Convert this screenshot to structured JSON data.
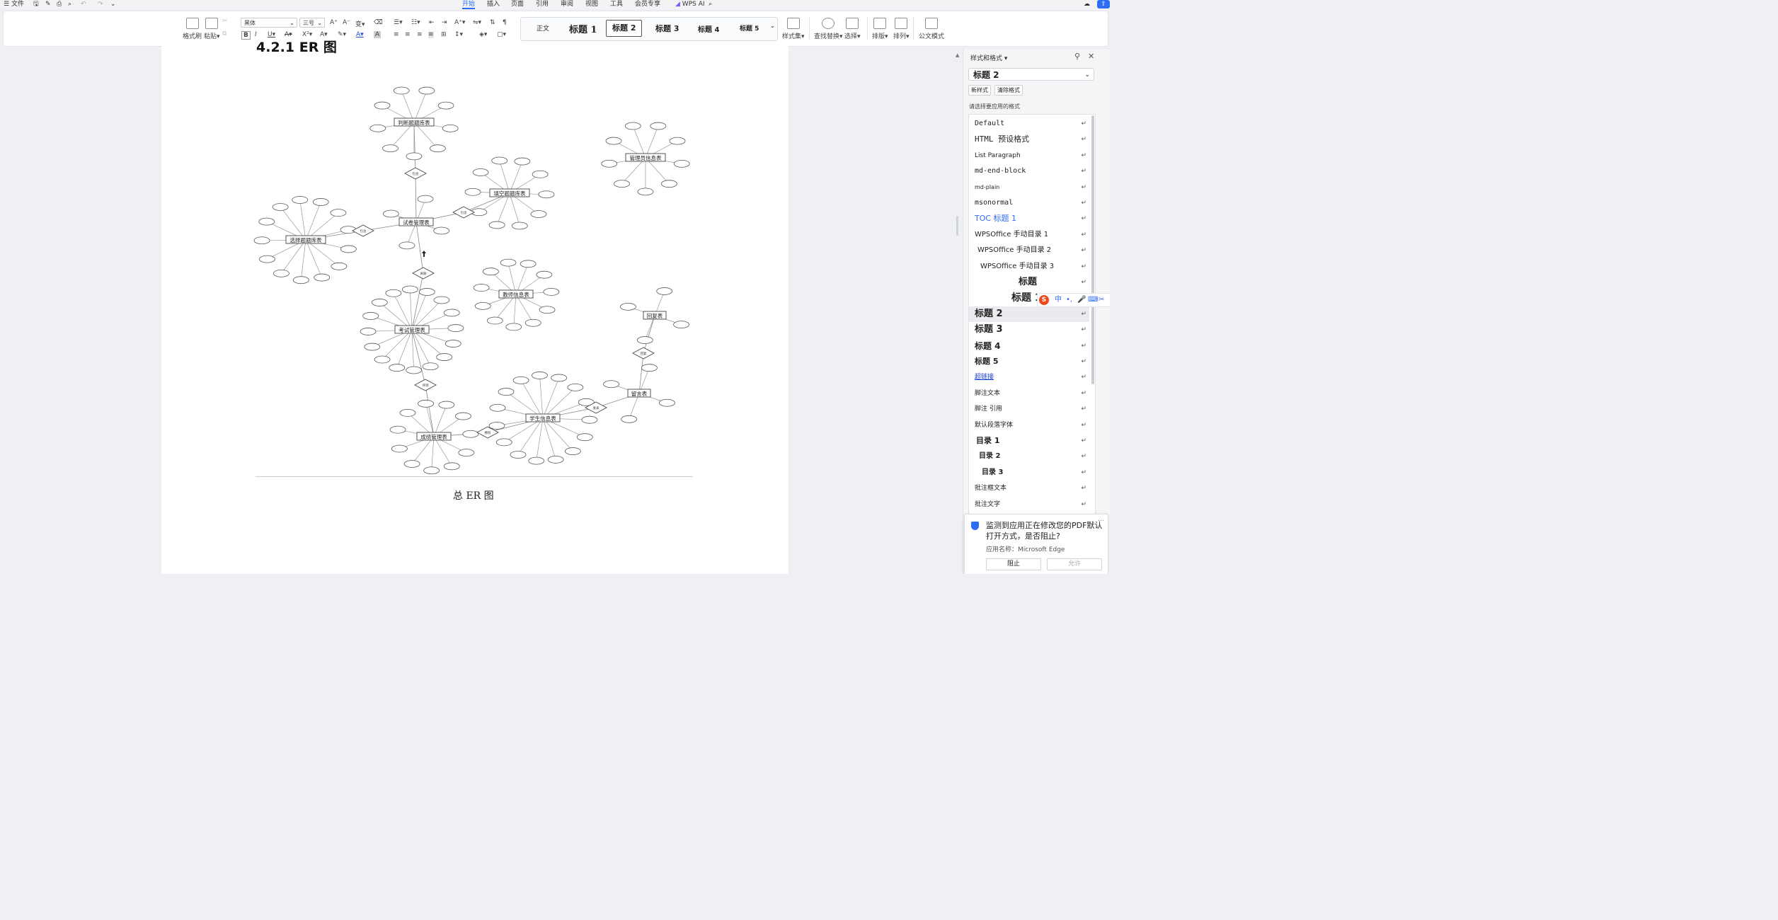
{
  "menu": {
    "file": "文件",
    "wps_ai": "WPS AI"
  },
  "tabs": [
    {
      "label": "开始",
      "active": true
    },
    {
      "label": "插入"
    },
    {
      "label": "页面"
    },
    {
      "label": "引用"
    },
    {
      "label": "审阅"
    },
    {
      "label": "视图"
    },
    {
      "label": "工具"
    },
    {
      "label": "会员专享"
    }
  ],
  "ribbon": {
    "format_painter": "格式刷",
    "paste": "粘贴",
    "font": "黑体",
    "size": "三号",
    "styles": [
      "正文",
      "标题 1",
      "标题 2",
      "标题 3",
      "标题 4",
      "标题 5"
    ],
    "style_set": "样式集",
    "find_replace": "查找替换",
    "select": "选择",
    "layout": "排版",
    "arrange": "排列",
    "official": "公文模式"
  },
  "document": {
    "heading": "4.2.1 ER 图",
    "caption": "总 ER 图"
  },
  "er_diagram": {
    "entities": [
      "判断题题库表",
      "填空题题库表",
      "试卷管理表",
      "选择题题库表",
      "管理员信息表",
      "教师信息表",
      "考试管理表",
      "回复表",
      "留言表",
      "学生信息表",
      "成绩管理表"
    ],
    "relations": [
      "包含",
      "包含",
      "包含",
      "关联",
      "评测",
      "拥有",
      "发表",
      "回复"
    ]
  },
  "panel": {
    "title": "样式和格式",
    "current": "标题 2",
    "new_style": "新样式",
    "clear": "清除格式",
    "hint": "请选择要应用的格式",
    "items": [
      "Default",
      "HTML 预设格式",
      "List Paragraph",
      "md-end-block",
      "md-plain",
      "msonormal",
      "TOC 标题 1",
      "WPSOffice 手动目录 1",
      "WPSOffice 手动目录 2",
      "WPSOffice 手动目录 3",
      "标题",
      "标题 1",
      "标题 2",
      "标题 3",
      "标题 4",
      "标题 5",
      "超链接",
      "脚注文本",
      "脚注 引用",
      "默认段落字体",
      "目录 1",
      "目录 2",
      "目录 3",
      "批注框文本",
      "批注文字"
    ]
  },
  "ime": {
    "label": "中"
  },
  "toast": {
    "message": "监测到应用正在修改您的PDF默认打开方式，是否阻止?",
    "app": "应用名称：Microsoft Edge",
    "block": "阻止",
    "allow": "允许"
  }
}
